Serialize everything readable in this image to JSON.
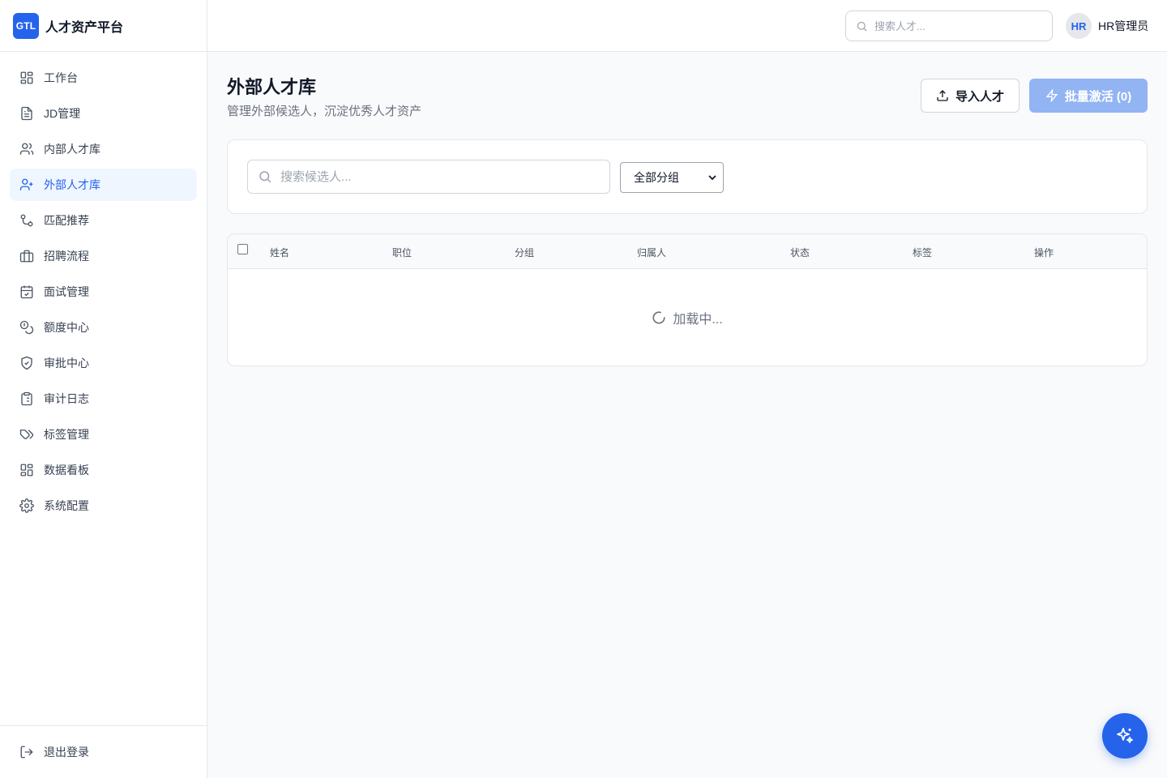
{
  "brand": {
    "logo_text": "GTL",
    "name": "人才资产平台"
  },
  "sidebar": {
    "items": [
      {
        "label": "工作台",
        "icon": "dashboard-icon",
        "active": false
      },
      {
        "label": "JD管理",
        "icon": "document-icon",
        "active": false
      },
      {
        "label": "内部人才库",
        "icon": "users-icon",
        "active": false
      },
      {
        "label": "外部人才库",
        "icon": "user-plus-icon",
        "active": true
      },
      {
        "label": "匹配推荐",
        "icon": "git-compare-icon",
        "active": false
      },
      {
        "label": "招聘流程",
        "icon": "briefcase-icon",
        "active": false
      },
      {
        "label": "面试管理",
        "icon": "calendar-check-icon",
        "active": false
      },
      {
        "label": "额度中心",
        "icon": "coins-icon",
        "active": false
      },
      {
        "label": "审批中心",
        "icon": "shield-check-icon",
        "active": false
      },
      {
        "label": "审计日志",
        "icon": "clipboard-list-icon",
        "active": false
      },
      {
        "label": "标签管理",
        "icon": "tags-icon",
        "active": false
      },
      {
        "label": "数据看板",
        "icon": "grid-icon",
        "active": false
      },
      {
        "label": "系统配置",
        "icon": "gear-icon",
        "active": false
      }
    ],
    "logout_label": "退出登录"
  },
  "header": {
    "search_placeholder": "搜索人才...",
    "avatar_text": "HR",
    "user_name": "HR管理员"
  },
  "page": {
    "title": "外部人才库",
    "subtitle": "管理外部候选人，沉淀优秀人才资产",
    "import_label": "导入人才",
    "activate_label": "批量激活 (0)"
  },
  "filters": {
    "search_placeholder": "搜索候选人...",
    "group_selected": "全部分组"
  },
  "table": {
    "columns": [
      "姓名",
      "职位",
      "分组",
      "归属人",
      "状态",
      "标签",
      "操作"
    ],
    "loading_text": "加载中..."
  },
  "colors": {
    "accent": "#2563eb",
    "accent_light": "#eff6ff",
    "disabled_button": "#93b4f3"
  }
}
